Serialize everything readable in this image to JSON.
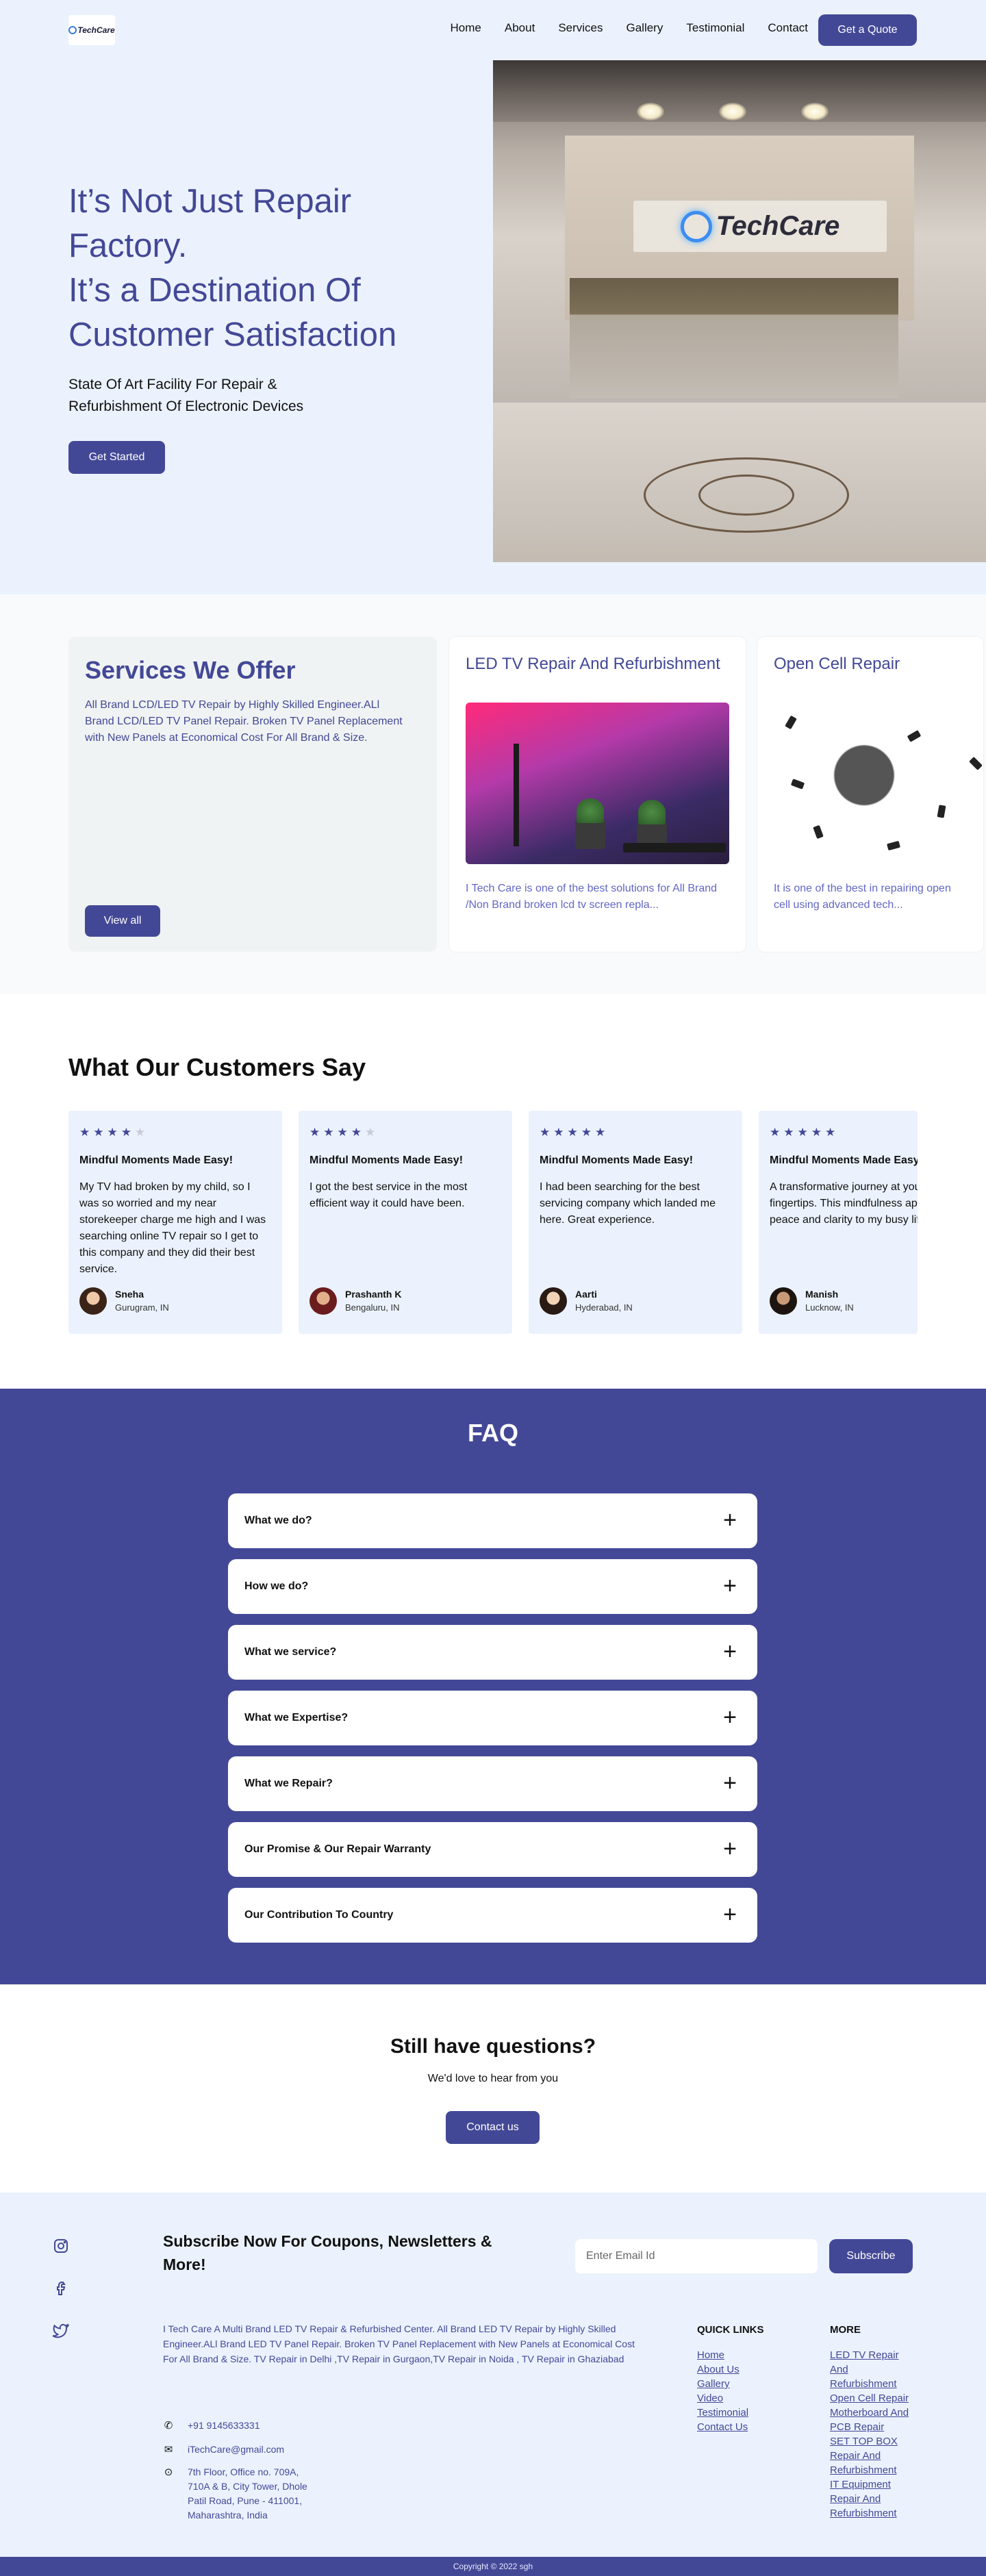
{
  "nav": {
    "logo_text": "TechCare",
    "links": [
      "Home",
      "About",
      "Services",
      "Gallery",
      "Testimonial",
      "Contact"
    ],
    "quote_button": "Get a Quote"
  },
  "hero": {
    "title": "It’s Not Just Repair Factory.\nIt’s a Destination Of Customer Satisfaction",
    "subtitle": "State Of Art Facility For Repair & Refurbishment Of Electronic Devices",
    "button": "Get Started",
    "image_sign_text": "TechCare"
  },
  "services": {
    "title": "Services We Offer",
    "description": "All Brand LCD/LED TV Repair by Highly Skilled Engineer.ALl Brand LCD/LED TV Panel Repair. Broken TV Panel Replacement with New Panels at Economical Cost For All Brand & Size.",
    "button": "View all",
    "cards": [
      {
        "title": "LED TV Repair And Refurbishment",
        "text": "I Tech Care is one of the best solutions for All Brand /Non Brand broken lcd tv screen repla..."
      },
      {
        "title": "Open Cell Repair",
        "text": "It is one of the best in repairing open cell using  advanced tech..."
      }
    ]
  },
  "testimonials": {
    "title": "What Our Customers Say",
    "items": [
      {
        "stars": 4,
        "heading": "Mindful Moments Made Easy!",
        "text": "My TV had broken by my child, so I was so worried and my near storekeeper charge me high and I was searching online TV repair so I get to this company and they did their best service.",
        "name": "Sneha",
        "location": "Gurugram, IN"
      },
      {
        "stars": 4,
        "heading": "Mindful Moments Made Easy!",
        "text": "I got the best service in the most efficient way it could have been.",
        "name": "Prashanth K",
        "location": "Bengaluru, IN"
      },
      {
        "stars": 5,
        "heading": "Mindful Moments Made Easy!",
        "text": "I had been searching for the best servicing company which landed me here. Great experience.",
        "name": "Aarti",
        "location": "Hyderabad, IN"
      },
      {
        "stars": 5,
        "heading": "Mindful Moments Made Easy!",
        "text": "A transformative journey at your fingertips. This mindfulness app brings peace and clarity to my busy life.",
        "name": "Manish",
        "location": "Lucknow, IN"
      }
    ]
  },
  "faq": {
    "title": "FAQ",
    "items": [
      "What we do?",
      "How we do?",
      "What we service?",
      "What we Expertise?",
      "What we Repair?",
      "Our Promise & Our Repair Warranty",
      "Our Contribution To Country"
    ]
  },
  "still": {
    "title": "Still have questions?",
    "subtitle": "We'd love to hear from you",
    "button": "Contact us"
  },
  "footer": {
    "subscribe_title": "Subscribe Now For Coupons, Newsletters & More!",
    "email_placeholder": "Enter Email Id",
    "subscribe_button": "Subscribe",
    "about": "I Tech Care A Multi Brand LED TV Repair & Refurbished Center. All Brand LED TV Repair by Highly Skilled Engineer.ALl Brand LED TV Panel Repair. Broken TV Panel Replacement with New Panels at Economical Cost For All Brand & Size. TV Repair in Delhi ,TV Repair in Gurgaon,TV Repair in Noida , TV Repair in Ghaziabad",
    "phone": "+91 9145633331",
    "email": "iTechCare@gmail.com",
    "address": "7th Floor, Office no. 709A, 710A & B, City Tower, Dhole Patil Road, Pune - 411001, Maharashtra, India",
    "quick_links_title": "QUICK LINKS",
    "quick_links": [
      "Home",
      "About Us",
      "Gallery",
      "Video",
      "Testimonial",
      "Contact Us"
    ],
    "more_title": "MORE",
    "more_links": [
      "LED TV Repair And Refurbishment",
      "Open Cell Repair",
      "Motherboard And PCB Repair",
      "SET TOP BOX Repair And Refurbishment",
      "IT Equipment Repair And Refurbishment"
    ],
    "copyright": "Copyright © 2022 sgh",
    "social_icons": [
      "instagram-icon",
      "facebook-icon",
      "twitter-icon"
    ]
  },
  "colors": {
    "primary": "#434896",
    "light_bg": "#ebf2fd"
  }
}
